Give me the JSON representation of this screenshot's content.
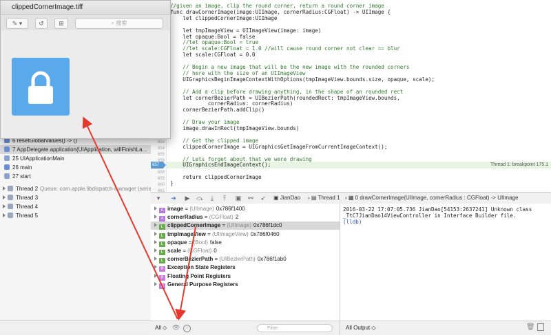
{
  "preview": {
    "title": "clippedCornerImage.tiff",
    "search_placeholder": "搜索"
  },
  "navigator": {
    "frames": [
      {
        "label": "6 resetGlobalValues() -> ()",
        "icon_color": "#6b8fd6"
      },
      {
        "label": "7 AppDelegate.application(UIApplication, willFinishLa...",
        "icon_color": "#6b8fd6"
      },
      {
        "label": "25 UIApplicationMain",
        "icon_color": "#8aa4cc"
      },
      {
        "label": "26 main",
        "icon_color": "#6b8fd6"
      },
      {
        "label": "27 start",
        "icon_color": "#8aa4cc"
      }
    ],
    "threads": [
      {
        "label": "Thread 2",
        "detail": "Queue: com.apple.libdispatch-manager (serial)"
      },
      {
        "label": "Thread 3",
        "detail": ""
      },
      {
        "label": "Thread 4",
        "detail": ""
      },
      {
        "label": "Thread 5",
        "detail": ""
      }
    ]
  },
  "editor": {
    "line_numbers": [
      "631",
      "632",
      "633",
      "634",
      "635",
      "636",
      "637",
      "638",
      "639",
      "640",
      "641",
      "642",
      "643",
      "644",
      "645",
      "646",
      "647",
      "648",
      "649",
      "650",
      "651",
      "652",
      "653",
      "654",
      "655",
      "656",
      "657",
      "658",
      "659",
      "660",
      "661"
    ],
    "lines": [
      {
        "text": "//given an image, clip the round corner, return a round corner image",
        "kind": "cm"
      },
      {
        "text": "func drawCornerImage(image:UIImage, cornerRadius:CGFloat) -> UIImage {",
        "kind": "code"
      },
      {
        "text": "    let clippedCornerImage:UIImage",
        "kind": "code"
      },
      {
        "text": "",
        "kind": "code"
      },
      {
        "text": "    let tmpImageView = UIImageView(image: image)",
        "kind": "code"
      },
      {
        "text": "    let opaque:Bool = false",
        "kind": "code"
      },
      {
        "text": "    //let opaque:Bool = true",
        "kind": "cm"
      },
      {
        "text": "    //let scale:CGFloat = 1.0 //will cause round corner not clear == blur",
        "kind": "cm"
      },
      {
        "text": "    let scale:CGFloat = 0.0",
        "kind": "code"
      },
      {
        "text": "",
        "kind": "code"
      },
      {
        "text": "    // Begin a new image that will be the new image with the rounded corners",
        "kind": "cm"
      },
      {
        "text": "    // here with the size of an UIImageView",
        "kind": "cm"
      },
      {
        "text": "    UIGraphicsBeginImageContextWithOptions(tmpImageView.bounds.size, opaque, scale);",
        "kind": "code"
      },
      {
        "text": "",
        "kind": "code"
      },
      {
        "text": "    // Add a clip before drawing anything, in the shape of an rounded rect",
        "kind": "cm"
      },
      {
        "text": "    let cornerBezierPath = UIBezierPath(roundedRect: tmpImageView.bounds,",
        "kind": "code"
      },
      {
        "text": "            cornerRadius: cornerRadius)",
        "kind": "code"
      },
      {
        "text": "    cornerBezierPath.addClip()",
        "kind": "code"
      },
      {
        "text": "",
        "kind": "code"
      },
      {
        "text": "    // Draw your image",
        "kind": "cm"
      },
      {
        "text": "    image.drawInRect(tmpImageView.bounds)",
        "kind": "code"
      },
      {
        "text": "",
        "kind": "code"
      },
      {
        "text": "    // Get the clipped image",
        "kind": "cm"
      },
      {
        "text": "    clippedCornerImage = UIGraphicsGetImageFromCurrentImageContext();",
        "kind": "code"
      },
      {
        "text": "",
        "kind": "code"
      },
      {
        "text": "    // Lets forget about that we were drawing",
        "kind": "cm"
      },
      {
        "text": "    UIGraphicsEndImageContext();",
        "kind": "code"
      },
      {
        "text": "",
        "kind": "code"
      },
      {
        "text": "    return clippedCornerImage",
        "kind": "code"
      },
      {
        "text": "}",
        "kind": "code"
      },
      {
        "text": "",
        "kind": "code"
      }
    ],
    "breakpoint_line": "657",
    "breakpoint_label": "Thread 1: breakpoint 175.1"
  },
  "debugbar": {
    "target": "JianDao",
    "thread": "Thread 1",
    "frame": "0 drawCornerImage(UIImage, cornerRadius : CGFloat) -> UIImage"
  },
  "variables": [
    {
      "badge": "A",
      "badge_color": "#b07ad6",
      "name": "image",
      "type": "(UIImage)",
      "value": "0x786f1400"
    },
    {
      "badge": "A",
      "badge_color": "#b07ad6",
      "name": "cornerRadius",
      "type": "(CGFloat)",
      "value": "2"
    },
    {
      "badge": "L",
      "badge_color": "#6aa84f",
      "name": "clippedCornerImage",
      "type": "(UIImage)",
      "value": "0x786f1dc0"
    },
    {
      "badge": "L",
      "badge_color": "#6aa84f",
      "name": "tmpImageView",
      "type": "(UIImageView)",
      "value": "0x786f0460"
    },
    {
      "badge": "L",
      "badge_color": "#6aa84f",
      "name": "opaque",
      "type": "(Bool)",
      "value": "false"
    },
    {
      "badge": "L",
      "badge_color": "#6aa84f",
      "name": "scale",
      "type": "(CGFloat)",
      "value": "0"
    },
    {
      "badge": "L",
      "badge_color": "#6aa84f",
      "name": "cornerBezierPath",
      "type": "(UIBezierPath)",
      "value": "0x786f1ab0"
    },
    {
      "badge": "R",
      "badge_color": "#c47bd8",
      "name": "Exception State Registers",
      "type": "",
      "value": ""
    },
    {
      "badge": "R",
      "badge_color": "#c47bd8",
      "name": "Floating Point Registers",
      "type": "",
      "value": ""
    },
    {
      "badge": "R",
      "badge_color": "#c47bd8",
      "name": "General Purpose Registers",
      "type": "",
      "value": ""
    }
  ],
  "console": {
    "line1": "2016-03-22 17:07:05.736 JianDao[54153:2637241] Unknown class _TtC7JianDao14ViewController in Interface Builder file.",
    "prompt": "(lldb)"
  },
  "vars_bottom": {
    "scope": "All ◇",
    "filter_placeholder": "Filter"
  },
  "console_bottom": {
    "scope": "All Output ◇"
  },
  "colors": {
    "accent": "#5aa9ea",
    "arrow": "#e8372c",
    "comment": "#317a2b"
  }
}
